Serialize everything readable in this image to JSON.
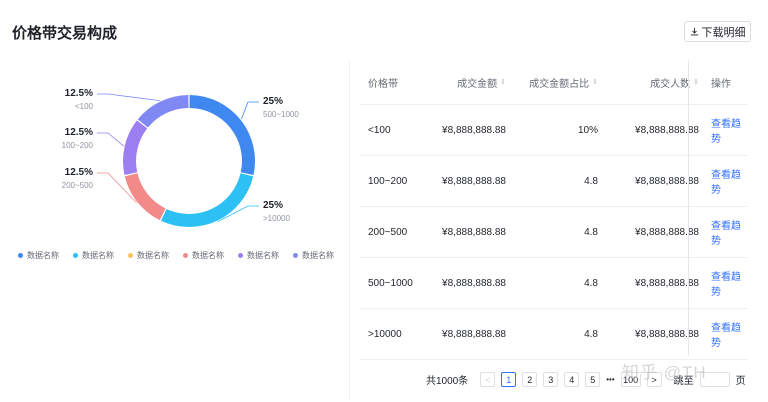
{
  "header": {
    "title": "价格带交易构成",
    "download_label": "下载明细"
  },
  "chart_data": {
    "type": "pie",
    "donut": true,
    "slices": [
      {
        "pct_label": "25%",
        "label": "500~1000",
        "value": 25,
        "color": "#3e88f0"
      },
      {
        "pct_label": "25%",
        "label": ">10000",
        "value": 25,
        "color": "#2cc0f4"
      },
      {
        "pct_label": "12.5%",
        "label": "200~500",
        "value": 12.5,
        "color": "#f28a8a"
      },
      {
        "pct_label": "12.5%",
        "label": "100~200",
        "value": 12.5,
        "color": "#9b7ff0"
      },
      {
        "pct_label": "12.5%",
        "label": "<100",
        "value": 12.5,
        "color": "#7f88f3"
      }
    ],
    "gap_color": "#ffffff",
    "legend": [
      {
        "label": "数据名称",
        "color": "#3e88f0"
      },
      {
        "label": "数据名称",
        "color": "#2cc0f4"
      },
      {
        "label": "数据名称",
        "color": "#f7c45c"
      },
      {
        "label": "数据名称",
        "color": "#f28a8a"
      },
      {
        "label": "数据名称",
        "color": "#9b7ff0"
      },
      {
        "label": "数据名称",
        "color": "#7f88f3"
      }
    ]
  },
  "table": {
    "columns": [
      "价格带",
      "成交金额",
      "成交金额占比",
      "成交人数",
      "操作"
    ],
    "rows": [
      {
        "band": "<100",
        "amount": "¥8,888,888.88",
        "ratio": "10%",
        "buyers": "¥8,888,888.88",
        "action": "查看趋势"
      },
      {
        "band": "100~200",
        "amount": "¥8,888,888.88",
        "ratio": "4.8",
        "buyers": "¥8,888,888.88",
        "action": "查看趋势"
      },
      {
        "band": "200~500",
        "amount": "¥8,888,888.88",
        "ratio": "4.8",
        "buyers": "¥8,888,888.88",
        "action": "查看趋势"
      },
      {
        "band": "500~1000",
        "amount": "¥8,888,888.88",
        "ratio": "4.8",
        "buyers": "¥8,888,888.88",
        "action": "查看趋势"
      },
      {
        "band": ">10000",
        "amount": "¥8,888,888.88",
        "ratio": "4.8",
        "buyers": "¥8,888,888.88",
        "action": "查看趋势"
      }
    ]
  },
  "pagination": {
    "total_label": "共1000条",
    "prev": "<",
    "pages": [
      "1",
      "2",
      "3",
      "4",
      "5"
    ],
    "current": "1",
    "ellipsis": "•••",
    "last": "100",
    "next": ">",
    "jump_label": "跳至",
    "page_unit": "页"
  },
  "watermark": "知乎 @TH"
}
